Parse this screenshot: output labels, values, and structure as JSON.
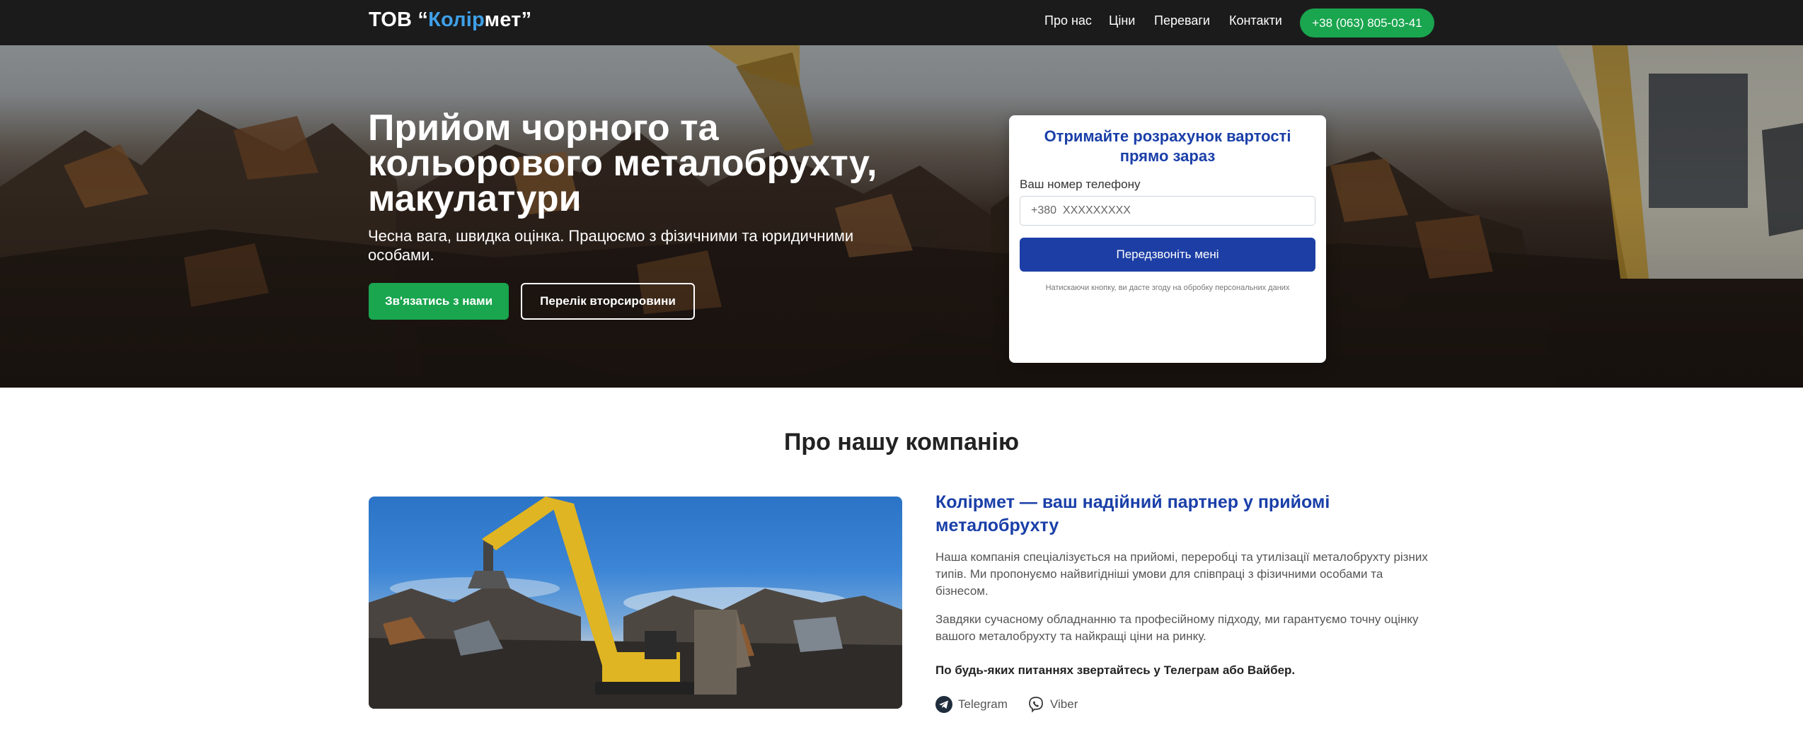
{
  "navbar": {
    "brand_prefix": "ТОВ “",
    "brand_part1": "Колір",
    "brand_part2": "мет",
    "brand_suffix": "”",
    "links": [
      "Про нас",
      "Ціни",
      "Переваги",
      "Контакти"
    ],
    "phone": "+38 (063) 805-03-41"
  },
  "hero": {
    "title": "Прийом чорного та кольорового металобрухту, макулатури",
    "subtitle": "Чесна вага, швидка оцінка. Працюємо з фізичними та юридичними особами.",
    "contact_button": "Зв'язатись з нами",
    "list_button": "Перелік вторсировини"
  },
  "form": {
    "title": "Отримайте розрахунок вартості прямо зараз",
    "phone_label": "Ваш номер телефону",
    "phone_placeholder": "+380  XXXXXXXXX",
    "submit": "Передзвоніть мені",
    "note": "Натискаючи кнопку, ви дасте згоду на обробку персональних даних"
  },
  "about": {
    "heading": "Про нашу компанію",
    "title": "Колірмет — ваш надійний партнер у прийомі металобрухту",
    "paragraph1": "Наша компанія спеціалізується на прийомі, переробці та утилізації металобрухту різних типів. Ми пропонуємо найвигідніші умови для співпраці з фізичними особами та бізнесом.",
    "paragraph2": "Завдяки сучасному обладнанню та професійному підходу, ми гарантуємо точну оцінку вашого металобрухту та найкращі ціни на ринку.",
    "contact_note": "По будь-яких питаннях звертайтесь у Телеграм або Вайбер.",
    "telegram": "Telegram",
    "viber": "Viber"
  },
  "colors": {
    "navbar_bg": "#1b1b1c",
    "accent_green": "#1aa54f",
    "accent_blue": "#1c3ea5",
    "brand_blue": "#3fa0e8"
  },
  "icons": {
    "telegram": "telegram-icon",
    "viber": "viber-icon"
  }
}
